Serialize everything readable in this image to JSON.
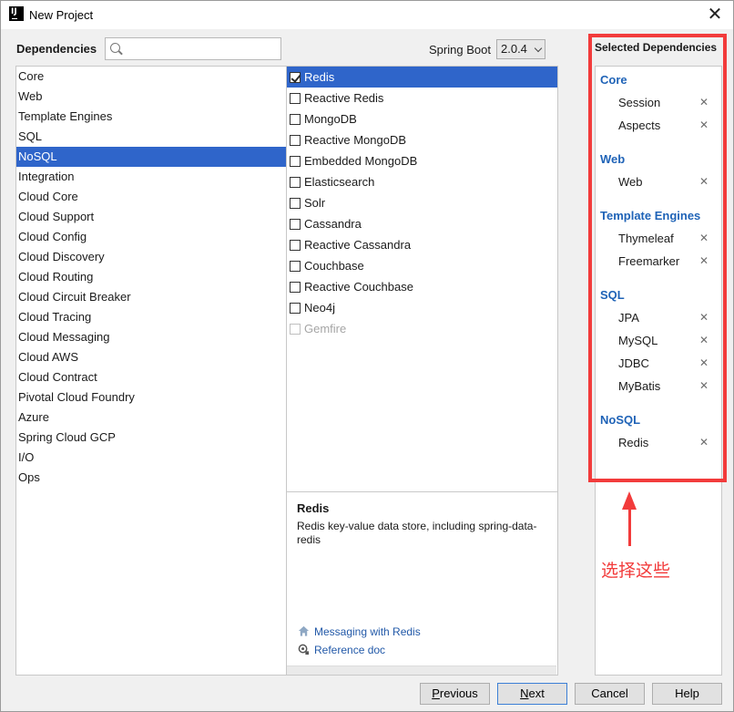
{
  "window": {
    "title": "New Project"
  },
  "toolbar": {
    "dependencies_label": "Dependencies",
    "search_placeholder": "",
    "spring_boot_label": "Spring Boot",
    "spring_boot_version": "2.0.4"
  },
  "categories": [
    {
      "label": "Core"
    },
    {
      "label": "Web"
    },
    {
      "label": "Template Engines"
    },
    {
      "label": "SQL"
    },
    {
      "label": "NoSQL",
      "selected": true
    },
    {
      "label": "Integration"
    },
    {
      "label": "Cloud Core"
    },
    {
      "label": "Cloud Support"
    },
    {
      "label": "Cloud Config"
    },
    {
      "label": "Cloud Discovery"
    },
    {
      "label": "Cloud Routing"
    },
    {
      "label": "Cloud Circuit Breaker"
    },
    {
      "label": "Cloud Tracing"
    },
    {
      "label": "Cloud Messaging"
    },
    {
      "label": "Cloud AWS"
    },
    {
      "label": "Cloud Contract"
    },
    {
      "label": "Pivotal Cloud Foundry"
    },
    {
      "label": "Azure"
    },
    {
      "label": "Spring Cloud GCP"
    },
    {
      "label": "I/O"
    },
    {
      "label": "Ops"
    }
  ],
  "dependencies": [
    {
      "label": "Redis",
      "checked": true,
      "selected": true
    },
    {
      "label": "Reactive Redis"
    },
    {
      "label": "MongoDB"
    },
    {
      "label": "Reactive MongoDB"
    },
    {
      "label": "Embedded MongoDB"
    },
    {
      "label": "Elasticsearch"
    },
    {
      "label": "Solr"
    },
    {
      "label": "Cassandra"
    },
    {
      "label": "Reactive Cassandra"
    },
    {
      "label": "Couchbase"
    },
    {
      "label": "Reactive Couchbase"
    },
    {
      "label": "Neo4j"
    },
    {
      "label": "Gemfire",
      "disabled": true
    }
  ],
  "description": {
    "title": "Redis",
    "text": "Redis key-value data store, including spring-data-redis",
    "link_guide": "Messaging with Redis",
    "link_reference": "Reference doc"
  },
  "selected_panel": {
    "header": "Selected Dependencies",
    "groups": [
      {
        "name": "Core",
        "items": [
          "Session",
          "Aspects"
        ]
      },
      {
        "name": "Web",
        "items": [
          "Web"
        ]
      },
      {
        "name": "Template Engines",
        "items": [
          "Thymeleaf",
          "Freemarker"
        ]
      },
      {
        "name": "SQL",
        "items": [
          "JPA",
          "MySQL",
          "JDBC",
          "MyBatis"
        ]
      },
      {
        "name": "NoSQL",
        "items": [
          "Redis"
        ]
      }
    ],
    "remove_glyph": "✕"
  },
  "annotation": {
    "text": "选择这些",
    "color": "#f23b3b"
  },
  "buttons": {
    "previous_first": "P",
    "previous_rest": "revious",
    "next_first": "N",
    "next_rest": "ext",
    "cancel": "Cancel",
    "help": "Help"
  },
  "colors": {
    "selection": "#2f65ca",
    "group_title": "#1f63b7",
    "link": "#2259a8"
  }
}
